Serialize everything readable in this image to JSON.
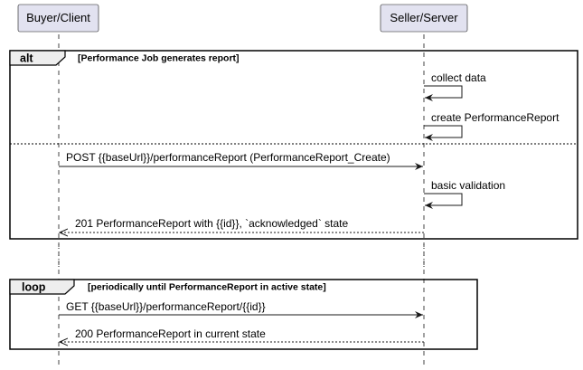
{
  "participants": {
    "buyer": "Buyer/Client",
    "seller": "Seller/Server"
  },
  "fragments": {
    "alt": {
      "keyword": "alt",
      "condition": "[Performance Job generates report]"
    },
    "loop": {
      "keyword": "loop",
      "condition": "[periodically until PerformanceReport in active state]"
    }
  },
  "messages": {
    "collect_data": "collect data",
    "create_report": "create PerformanceReport",
    "post_request": "POST {{baseUrl}}/performanceReport (PerformanceReport_Create)",
    "basic_validation": "basic validation",
    "post_response": "201 PerformanceReport with {{id}}, `acknowledged` state",
    "get_request": "GET {{baseUrl}}/performanceReport/{{id}}",
    "get_response": "200 PerformanceReport in current state"
  },
  "colors": {
    "participant_fill": "#E2E2F0",
    "participant_border": "#181818",
    "lifeline": "#181818",
    "frame": "#000000"
  }
}
